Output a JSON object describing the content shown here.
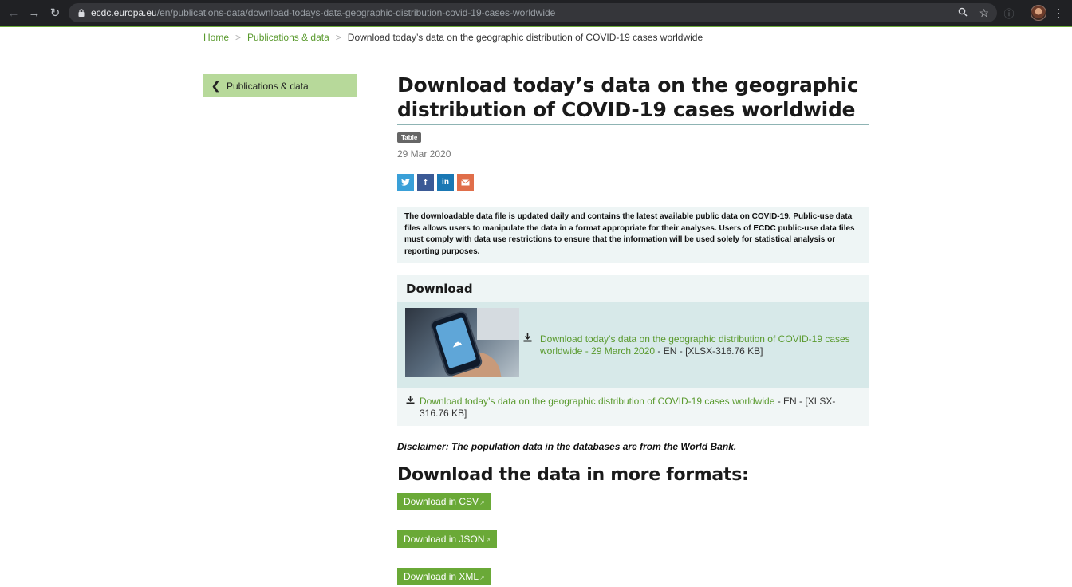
{
  "browser": {
    "url_host": "ecdc.europa.eu",
    "url_path": "/en/publications-data/download-todays-data-geographic-distribution-covid-19-cases-worldwide"
  },
  "breadcrumb": {
    "home": "Home",
    "section": "Publications & data",
    "current": "Download today’s data on the geographic distribution of COVID-19 cases worldwide"
  },
  "sidebar": {
    "back_label": "Publications & data"
  },
  "article": {
    "title": "Download today’s data on the geographic distribution of COVID-19 cases worldwide",
    "badge": "Table",
    "date": "29 Mar 2020",
    "intro": "The downloadable data file is updated daily and contains the latest available public data on COVID-19. Public-use data files allows users to manipulate the data in a format appropriate for their analyses. Users of ECDC public-use data files must comply with data use restrictions to ensure that the information will be used solely for statistical analysis or reporting purposes."
  },
  "download": {
    "heading": "Download",
    "featured_link": "Download today’s data on the geographic distribution of COVID-19 cases worldwide - 29 March 2020",
    "featured_meta": " - EN - [XLSX-316.76 KB]",
    "plain_link": "Download today’s data on the geographic distribution of COVID-19 cases worldwide",
    "plain_meta": " - EN - [XLSX-316.76 KB]"
  },
  "disclaimer": "Disclaimer: The population data in the databases are from the World Bank.",
  "formats": {
    "heading": "Download the data in more formats:",
    "csv": "Download in CSV",
    "json": "Download in JSON",
    "xml": "Download in XML"
  },
  "colors": {
    "accent_green": "#6aa937",
    "link_green": "#5a9a2e",
    "panel": "#eef5f5"
  }
}
